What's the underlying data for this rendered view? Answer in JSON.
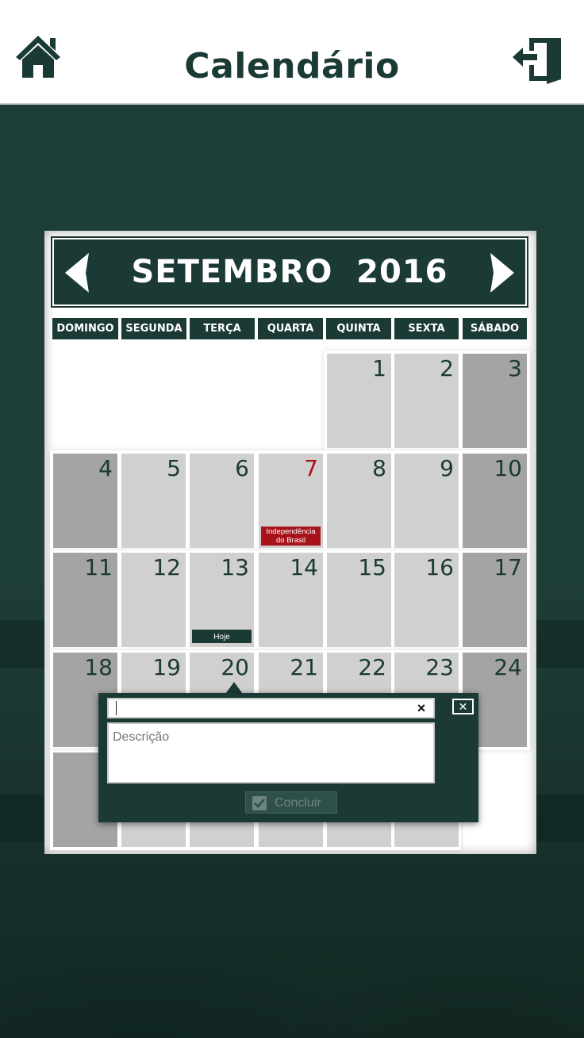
{
  "header": {
    "title": "Calendário",
    "home_icon": "home-icon",
    "exit_icon": "exit-door-icon"
  },
  "calendar": {
    "month_label": "SETEMBRO  2016",
    "prev_icon": "chevron-left-icon",
    "next_icon": "chevron-right-icon",
    "weekdays": [
      "DOMINGO",
      "SEGUNDA",
      "TERÇA",
      "QUARTA",
      "QUINTA",
      "SEXTA",
      "SÁBADO"
    ],
    "days": {
      "d1": "1",
      "d2": "2",
      "d3": "3",
      "d4": "4",
      "d5": "5",
      "d6": "6",
      "d7": "7",
      "d8": "8",
      "d9": "9",
      "d10": "10",
      "d11": "11",
      "d12": "12",
      "d13": "13",
      "d14": "14",
      "d15": "15",
      "d16": "16",
      "d17": "17",
      "d18": "18",
      "d19": "19",
      "d20": "20",
      "d21": "21",
      "d22": "22",
      "d23": "23",
      "d24": "24",
      "d25": "2"
    },
    "holiday_event": "Independência do Brasil",
    "today_event": "Hoje"
  },
  "popover": {
    "title_value": "",
    "clear_label": "×",
    "close_label": "✕",
    "description_placeholder": "Descrição",
    "done_label": "Concluir",
    "done_icon": "checkbox-check-icon"
  },
  "colors": {
    "brand": "#1b3a35",
    "weekday_cell": "#d0d0d0",
    "weekend_cell": "#a4a4a4",
    "holiday": "#a8131b"
  }
}
